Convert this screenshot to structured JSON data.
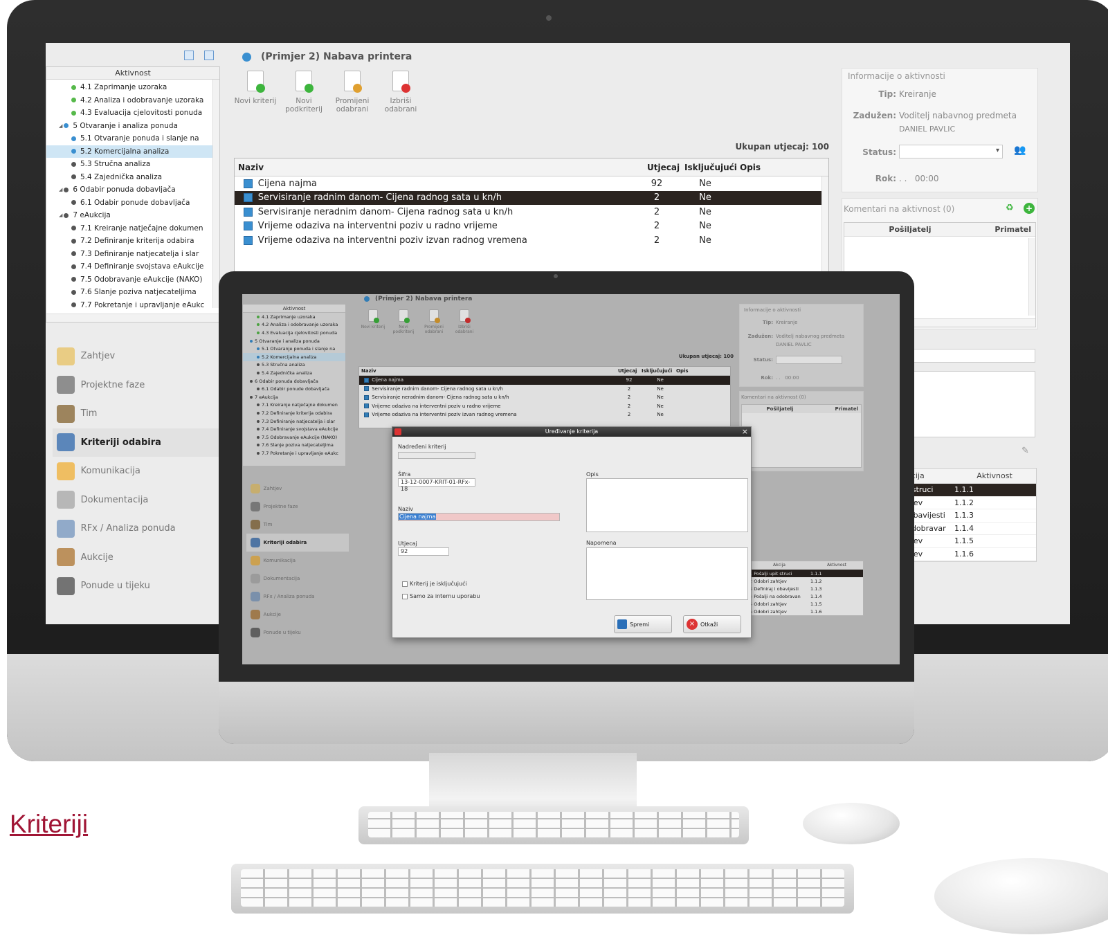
{
  "caption": "Kriteriji",
  "app": {
    "title": "(Primjer 2) Nabava printera",
    "tree_header": "Aktivnost",
    "tree": [
      {
        "label": "4.1 Zaprimanje uzoraka",
        "level": 2,
        "color": "#56b94a"
      },
      {
        "label": "4.2 Analiza i odobravanje uzoraka",
        "level": 2,
        "color": "#56b94a"
      },
      {
        "label": "4.3 Evaluacija cjelovitosti ponuda",
        "level": 2,
        "color": "#56b94a"
      },
      {
        "label": "5 Otvaranje i analiza ponuda",
        "level": 1,
        "color": "#3a8fd0"
      },
      {
        "label": "5.1 Otvaranje ponuda i slanje na",
        "level": 2,
        "color": "#3a8fd0"
      },
      {
        "label": "5.2 Komercijalna analiza",
        "level": 2,
        "color": "#3a8fd0",
        "selected": true
      },
      {
        "label": "5.3 Stručna analiza",
        "level": 2,
        "color": "#555"
      },
      {
        "label": "5.4 Zajednička analiza",
        "level": 2,
        "color": "#555"
      },
      {
        "label": "6 Odabir ponuda dobavljača",
        "level": 1,
        "color": "#555"
      },
      {
        "label": "6.1 Odabir ponude dobavljača",
        "level": 2,
        "color": "#555"
      },
      {
        "label": "7 eAukcija",
        "level": 1,
        "color": "#555"
      },
      {
        "label": "7.1 Kreiranje natječajne dokumen",
        "level": 2,
        "color": "#555"
      },
      {
        "label": "7.2 Definiranje kriterija odabira",
        "level": 2,
        "color": "#555"
      },
      {
        "label": "7.3 Definiranje natjecatelja i slar",
        "level": 2,
        "color": "#555"
      },
      {
        "label": "7.4 Definiranje svojstava eAukcije",
        "level": 2,
        "color": "#555"
      },
      {
        "label": "7.5 Odobravanje eAukcije (NAKO)",
        "level": 2,
        "color": "#555"
      },
      {
        "label": "7.6 Slanje poziva natjecateljima",
        "level": 2,
        "color": "#555"
      },
      {
        "label": "7.7 Pokretanje i upravljanje eAukc",
        "level": 2,
        "color": "#555"
      }
    ],
    "tree_small": [
      "4.2 Analiza i odobravanje uzoraki",
      "4.3 Evaluacija cjelovitosti ponuda",
      "7.1 Kreiranje natječajne dokumen",
      "7.3 Definiranje natjecatelja i slar",
      "7.4 Definiranje svojstava eAukcije",
      "7.7 Pokretanje i upravljanje eAukc"
    ],
    "nav": [
      {
        "label": "Zahtjev",
        "icon": "pencil-icon",
        "color": "#e9c46a"
      },
      {
        "label": "Projektne faze",
        "icon": "folder-icon",
        "color": "#777"
      },
      {
        "label": "Tim",
        "icon": "people-icon",
        "color": "#8a6a3a"
      },
      {
        "label": "Kriteriji odabira",
        "icon": "brush-icon",
        "color": "#3a6fb0",
        "active": true
      },
      {
        "label": "Komunikacija",
        "icon": "chat-icon",
        "color": "#f0b340"
      },
      {
        "label": "Dokumentacija",
        "icon": "documents-icon",
        "color": "#aaa"
      },
      {
        "label": "RFx / Analiza ponuda",
        "icon": "list-icon",
        "color": "#7a9ac0"
      },
      {
        "label": "Aukcije",
        "icon": "gavel-icon",
        "color": "#b07a3a"
      },
      {
        "label": "Ponude u tijeku",
        "icon": "binoculars-icon",
        "color": "#555"
      }
    ],
    "toolbar": [
      {
        "label1": "Novi kriterij",
        "label2": "",
        "icon": "new-document-icon",
        "badge": "#3db53d"
      },
      {
        "label1": "Novi",
        "label2": "podkriterij",
        "icon": "new-subdocument-icon",
        "badge": "#3db53d"
      },
      {
        "label1": "Promijeni",
        "label2": "odabrani",
        "icon": "edit-document-icon",
        "badge": "#e0a030"
      },
      {
        "label1": "Izbriši",
        "label2": "odabrani",
        "icon": "delete-document-icon",
        "badge": "#d33"
      }
    ],
    "total_impact": "Ukupan utjecaj: 100",
    "grid_headers": [
      "Naziv",
      "Utjecaj",
      "Isključujući",
      "Opis"
    ],
    "grid_rows": [
      {
        "naziv": "Cijena najma",
        "utjecaj": "92",
        "iskljucujuci": "Ne"
      },
      {
        "naziv": "Servisiranje radnim danom- Cijena radnog sata u kn/h",
        "utjecaj": "2",
        "iskljucujuci": "Ne"
      },
      {
        "naziv": "Servisiranje neradnim danom- Cijena radnog sata u kn/h",
        "utjecaj": "2",
        "iskljucujuci": "Ne"
      },
      {
        "naziv": "Vrijeme odaziva na interventni poziv u radno vrijeme",
        "utjecaj": "2",
        "iskljucujuci": "Ne"
      },
      {
        "naziv": "Vrijeme odaziva na interventni poziv izvan radnog vremena",
        "utjecaj": "2",
        "iskljucujuci": "Ne"
      }
    ],
    "info": {
      "title": "Informacije o aktivnosti",
      "tip_label": "Tip:",
      "tip_value": "Kreiranje",
      "zaduzen_label": "Zadužen:",
      "zaduzen_value1": "Voditelj nabavnog predmeta",
      "zaduzen_value2": "DANIEL PAVLIC",
      "status_label": "Status:",
      "rok_label": "Rok:",
      "rok_value": ". .   00:00"
    },
    "comments": {
      "title": "Komentari na aktivnost (0)",
      "col_sender": "Pošiljatelj",
      "col_receiver": "Primatel"
    },
    "actions": {
      "headers": [
        "Akcija",
        "Aktivnost"
      ],
      "rows": [
        {
          "akcija": "upit struci",
          "aktivnost": "1.1.1"
        },
        {
          "akcija": "zahtjev",
          "aktivnost": "1.1.2"
        },
        {
          "akcija": "aj i obavijesti",
          "aktivnost": "1.1.3"
        },
        {
          "akcija": "na odobravan",
          "aktivnost": "1.1.4"
        },
        {
          "akcija": "zahtjev",
          "aktivnost": "1.1.5"
        },
        {
          "akcija": "zahtjev",
          "aktivnost": "1.1.6"
        }
      ],
      "rows_small": [
        {
          "akcija": "1 Pošalji upit struci",
          "aktivnost": "1.1.1"
        },
        {
          "akcija": "2 Odobri zahtjev",
          "aktivnost": "1.1.2"
        },
        {
          "akcija": "3 Definiraj i obavijesti",
          "aktivnost": "1.1.3"
        },
        {
          "akcija": "4 Pošalji na odobravan",
          "aktivnost": "1.1.4"
        },
        {
          "akcija": "5 Odobri zahtjev",
          "aktivnost": "1.1.5"
        },
        {
          "akcija": "6 Odobri zahtjev",
          "aktivnost": "1.1.6"
        }
      ]
    }
  },
  "dialog": {
    "title": "Uređivanje kriterija",
    "parent_label": "Nadređeni kriterij",
    "code_label": "Šifra",
    "code_value": "13-12-0007-KRIT-01-RFx-18",
    "name_label": "Naziv",
    "name_value": "Cijena najma",
    "impact_label": "Utjecaj",
    "impact_value": "92",
    "desc_label": "Opis",
    "note_label": "Napomena",
    "exclusive_label": "Kriterij je isključujući",
    "internal_label": "Samo za internu uporabu",
    "save_label": "Spremi",
    "cancel_label": "Otkaži"
  }
}
